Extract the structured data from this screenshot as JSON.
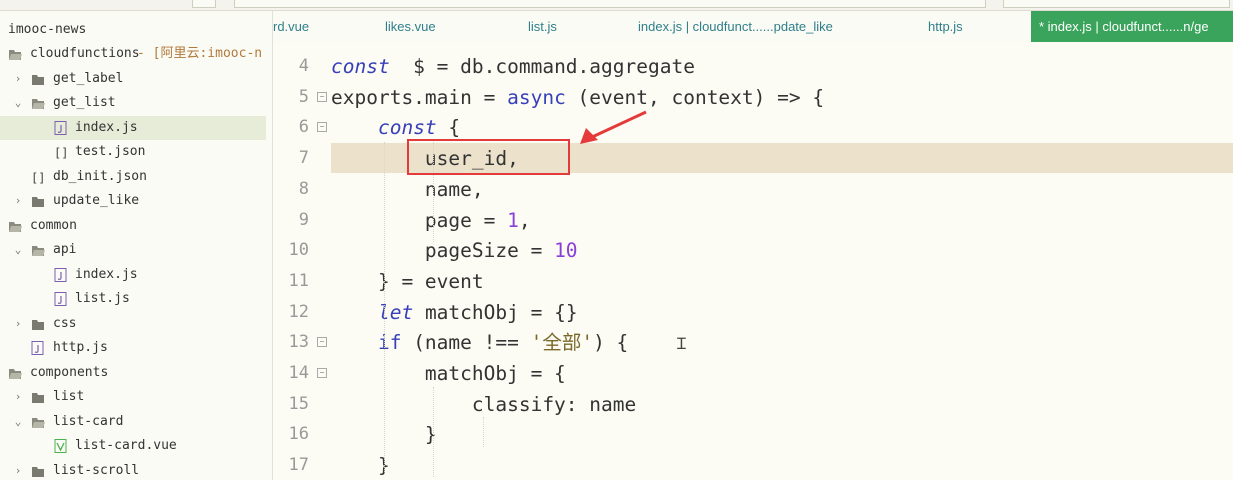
{
  "sidebar": {
    "items": [
      {
        "label": "imooc-news",
        "type": "project"
      },
      {
        "label": "cloudfunctions",
        "sub": " - [阿里云:imooc-n",
        "type": "folder-open"
      },
      {
        "label": "get_label",
        "type": "folder"
      },
      {
        "label": "get_list",
        "type": "folder-open"
      },
      {
        "label": "index.js",
        "type": "js-file"
      },
      {
        "label": "test.json",
        "type": "json-file"
      },
      {
        "label": "db_init.json",
        "type": "json-file"
      },
      {
        "label": "update_like",
        "type": "folder"
      },
      {
        "label": "common",
        "type": "folder-open"
      },
      {
        "label": "api",
        "type": "folder-open"
      },
      {
        "label": "index.js",
        "type": "js-file"
      },
      {
        "label": "list.js",
        "type": "js-file"
      },
      {
        "label": "css",
        "type": "folder"
      },
      {
        "label": "http.js",
        "type": "js-file"
      },
      {
        "label": "components",
        "type": "folder-open"
      },
      {
        "label": "list",
        "type": "folder"
      },
      {
        "label": "list-card",
        "type": "folder-open"
      },
      {
        "label": "list-card.vue",
        "type": "vue-file"
      },
      {
        "label": "list-scroll",
        "type": "folder"
      }
    ]
  },
  "tabs": [
    {
      "label": "rd.vue"
    },
    {
      "label": "likes.vue"
    },
    {
      "label": "list.js"
    },
    {
      "label": "index.js | cloudfunct......pdate_like"
    },
    {
      "label": "http.js"
    },
    {
      "label": "* index.js | cloudfunct......n/ge",
      "active": true
    }
  ],
  "editor": {
    "lines": [
      {
        "n": "4",
        "tokens": [
          [
            "kw",
            "const"
          ],
          [
            "",
            "  $ = db.command.aggregate"
          ]
        ]
      },
      {
        "n": "5",
        "tokens": [
          [
            "",
            "exports.main = "
          ],
          [
            "kw2",
            "async"
          ],
          [
            "",
            " (event, context) => {"
          ]
        ],
        "fold": true
      },
      {
        "n": "6",
        "tokens": [
          [
            "",
            "    "
          ],
          [
            "kw",
            "const"
          ],
          [
            "",
            " {"
          ]
        ],
        "fold": true
      },
      {
        "n": "7",
        "tokens": [
          [
            "",
            "        user_id,"
          ]
        ],
        "highlight": true
      },
      {
        "n": "8",
        "tokens": [
          [
            "",
            "        name,"
          ]
        ]
      },
      {
        "n": "9",
        "tokens": [
          [
            "",
            "        page = "
          ],
          [
            "num",
            "1"
          ],
          [
            "",
            ","
          ]
        ]
      },
      {
        "n": "10",
        "tokens": [
          [
            "",
            "        pageSize = "
          ],
          [
            "num",
            "10"
          ]
        ]
      },
      {
        "n": "11",
        "tokens": [
          [
            "",
            "    } = event"
          ]
        ]
      },
      {
        "n": "12",
        "tokens": [
          [
            "",
            "    "
          ],
          [
            "kw",
            "let"
          ],
          [
            "",
            " matchObj = {}"
          ]
        ]
      },
      {
        "n": "13",
        "tokens": [
          [
            "",
            "    "
          ],
          [
            "kw2",
            "if"
          ],
          [
            "",
            " (name !== "
          ],
          [
            "str",
            "'全部'"
          ],
          [
            "",
            ") {"
          ]
        ],
        "fold": true
      },
      {
        "n": "14",
        "tokens": [
          [
            "",
            "        matchObj = {"
          ]
        ],
        "fold": true
      },
      {
        "n": "15",
        "tokens": [
          [
            "",
            "            classify: name"
          ]
        ]
      },
      {
        "n": "16",
        "tokens": [
          [
            "",
            "        }"
          ]
        ]
      },
      {
        "n": "17",
        "tokens": [
          [
            "",
            "    }"
          ]
        ]
      }
    ]
  },
  "colors": {
    "accent_tab": "#3aa45c",
    "annotation": "#e53a3a",
    "line_highlight": "#ece2cb"
  }
}
